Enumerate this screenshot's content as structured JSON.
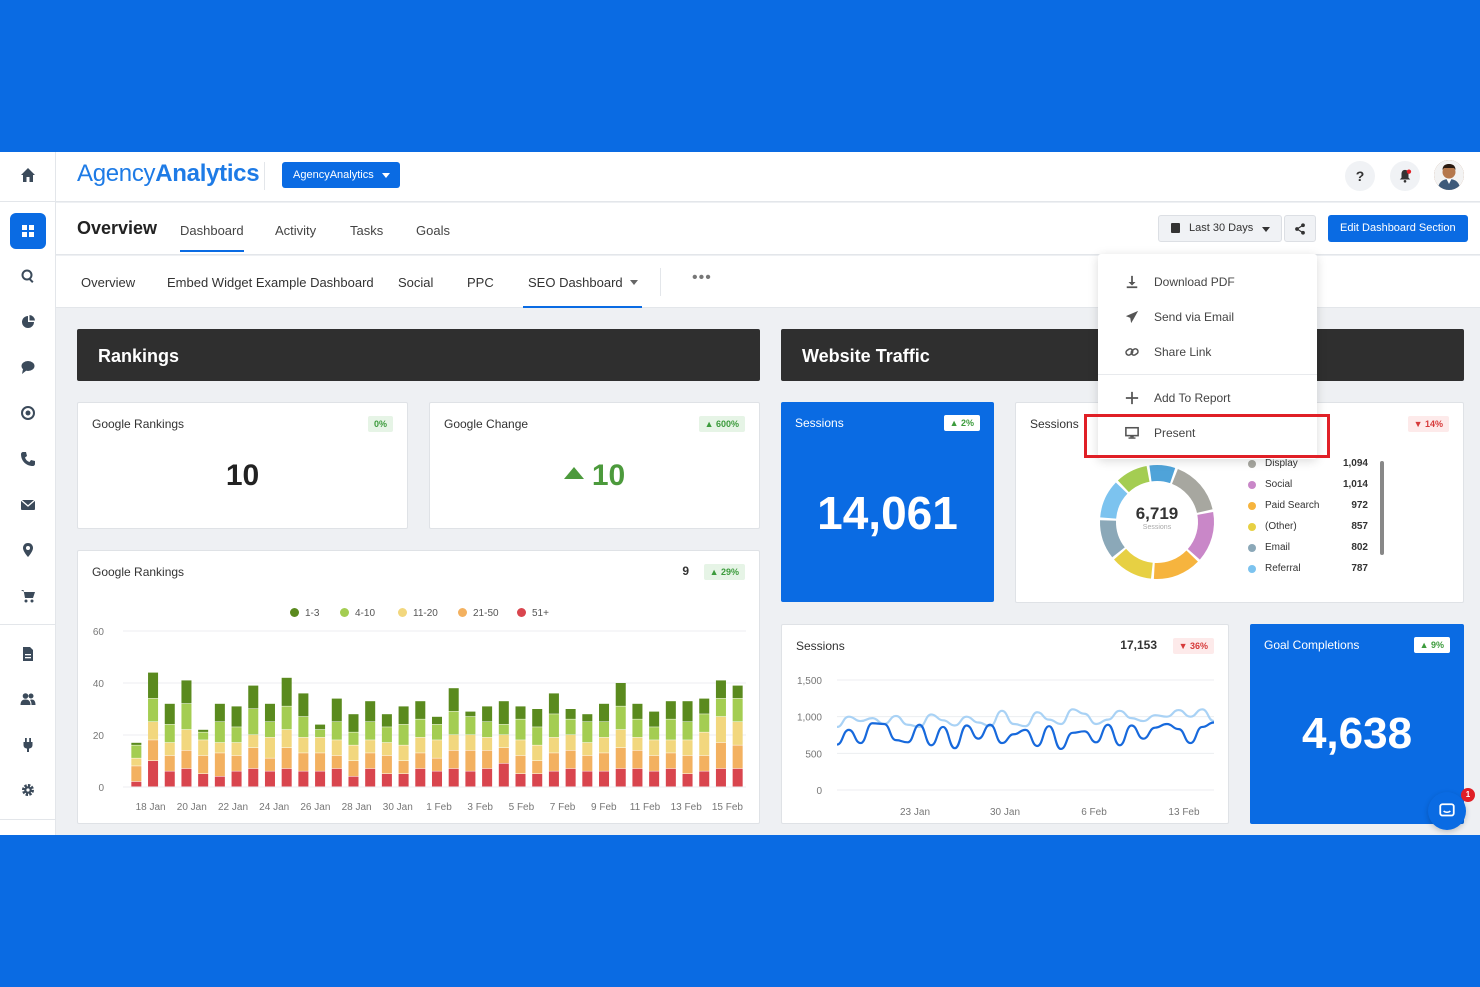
{
  "brand": {
    "logo_light": "Agency",
    "logo_bold": "Analytics",
    "account_button": "AgencyAnalytics"
  },
  "header": {
    "help": "?",
    "notification_count": ""
  },
  "nav": {
    "title": "Overview",
    "tabs": [
      "Dashboard",
      "Activity",
      "Tasks",
      "Goals"
    ],
    "date_range": "Last 30 Days",
    "edit_button": "Edit Dashboard Section"
  },
  "subtabs": [
    "Overview",
    "Embed Widget Example Dashboard",
    "Social",
    "PPC",
    "SEO Dashboard"
  ],
  "subtabs_more": "•••",
  "sections": {
    "rankings": "Rankings",
    "traffic": "Website Traffic"
  },
  "cards": {
    "google_rankings": {
      "title": "Google Rankings",
      "badge": "0%",
      "value": "10"
    },
    "google_change": {
      "title": "Google Change",
      "badge": "▲ 600%",
      "value": "10"
    },
    "rankings_chart": {
      "title": "Google Rankings",
      "value": "9",
      "badge": "▲ 29%"
    },
    "sessions": {
      "title": "Sessions",
      "badge": "▲ 2%",
      "value": "14,061"
    },
    "sessions_donut": {
      "title": "Sessions",
      "badge": "▼ 14%",
      "center_value": "6,719",
      "center_label": "Sessions"
    },
    "sessions_line": {
      "title": "Sessions",
      "value": "17,153",
      "badge": "▼ 36%"
    },
    "goal_completions": {
      "title": "Goal Completions",
      "badge": "▲ 9%",
      "value": "4,638"
    }
  },
  "traffic_sources": [
    {
      "name": "Display",
      "value": "1,094",
      "color": "#a7a7a0"
    },
    {
      "name": "Social",
      "value": "1,014",
      "color": "#c987c8"
    },
    {
      "name": "Paid Search",
      "value": "972",
      "color": "#f6b43e"
    },
    {
      "name": "(Other)",
      "value": "857",
      "color": "#e7d043"
    },
    {
      "name": "Email",
      "value": "802",
      "color": "#8ba8b8"
    },
    {
      "name": "Referral",
      "value": "787",
      "color": "#7cc3ef"
    }
  ],
  "dropdown": {
    "items": [
      "Download PDF",
      "Send via Email",
      "Share Link",
      "Add To Report",
      "Present"
    ]
  },
  "chat_badge": "1",
  "chart_data": [
    {
      "type": "bar",
      "stacked": true,
      "title": "Google Rankings",
      "x_labels": [
        "18 Jan",
        "20 Jan",
        "22 Jan",
        "24 Jan",
        "26 Jan",
        "28 Jan",
        "30 Jan",
        "1 Feb",
        "3 Feb",
        "5 Feb",
        "7 Feb",
        "9 Feb",
        "11 Feb",
        "13 Feb",
        "15 Feb"
      ],
      "y_ticks": [
        0,
        20,
        40,
        60
      ],
      "ylim": [
        0,
        60
      ],
      "legend": [
        {
          "name": "1-3",
          "color": "#5a8a1e"
        },
        {
          "name": "4-10",
          "color": "#a4cd52"
        },
        {
          "name": "11-20",
          "color": "#f2d77e"
        },
        {
          "name": "21-50",
          "color": "#f3b160"
        },
        {
          "name": "51+",
          "color": "#d9454e"
        }
      ],
      "stacks": [
        [
          1,
          5,
          3,
          6,
          2
        ],
        [
          10,
          9,
          7,
          8,
          10
        ],
        [
          8,
          7,
          5,
          6,
          6
        ],
        [
          9,
          10,
          8,
          7,
          7
        ],
        [
          1,
          3,
          6,
          7,
          5
        ],
        [
          7,
          8,
          4,
          9,
          4
        ],
        [
          8,
          6,
          5,
          6,
          6
        ],
        [
          9,
          10,
          5,
          8,
          7
        ],
        [
          7,
          6,
          8,
          5,
          6
        ],
        [
          11,
          9,
          7,
          8,
          7
        ],
        [
          9,
          8,
          6,
          7,
          6
        ],
        [
          2,
          3,
          6,
          7,
          6
        ],
        [
          9,
          7,
          6,
          5,
          7
        ],
        [
          7,
          5,
          6,
          6,
          4
        ],
        [
          8,
          7,
          5,
          6,
          7
        ],
        [
          5,
          6,
          5,
          7,
          5
        ],
        [
          7,
          8,
          6,
          5,
          5
        ],
        [
          7,
          7,
          6,
          6,
          7
        ],
        [
          3,
          6,
          7,
          5,
          6
        ],
        [
          9,
          9,
          6,
          7,
          7
        ],
        [
          2,
          7,
          6,
          8,
          6
        ],
        [
          6,
          6,
          5,
          7,
          7
        ],
        [
          9,
          4,
          5,
          6,
          9
        ],
        [
          5,
          8,
          6,
          7,
          5
        ],
        [
          7,
          7,
          6,
          5,
          5
        ],
        [
          8,
          9,
          6,
          7,
          6
        ],
        [
          4,
          6,
          6,
          7,
          7
        ],
        [
          3,
          8,
          5,
          6,
          6
        ],
        [
          7,
          6,
          6,
          7,
          6
        ],
        [
          9,
          9,
          7,
          8,
          7
        ],
        [
          6,
          7,
          5,
          7,
          7
        ],
        [
          6,
          5,
          6,
          6,
          6
        ],
        [
          7,
          8,
          5,
          6,
          7
        ],
        [
          8,
          7,
          6,
          7,
          5
        ],
        [
          6,
          7,
          9,
          6,
          6
        ],
        [
          7,
          7,
          10,
          10,
          7
        ],
        [
          5,
          9,
          9,
          9,
          7
        ]
      ]
    },
    {
      "type": "pie",
      "donut": true,
      "title": "Sessions",
      "labels": [
        "Display",
        "Social",
        "Paid Search",
        "(Other)",
        "Email",
        "Referral"
      ],
      "values": [
        1094,
        1014,
        972,
        857,
        802,
        787
      ]
    },
    {
      "type": "line",
      "title": "Sessions",
      "x_labels": [
        "23 Jan",
        "30 Jan",
        "6 Feb",
        "13 Feb"
      ],
      "y_ticks": [
        "0",
        "500",
        "1,000",
        "1,500"
      ],
      "ylim": [
        0,
        1500
      ],
      "series": [
        {
          "values": [
            620,
            820,
            640,
            910,
            900,
            680,
            650,
            890,
            610,
            860,
            570,
            880,
            700,
            890,
            640,
            760,
            820,
            600,
            870,
            560,
            780,
            800,
            650,
            890,
            610,
            880,
            700,
            850,
            900,
            830,
            640,
            860,
            920
          ],
          "color": "#1769dc"
        },
        {
          "values": [
            860,
            1000,
            940,
            980,
            900,
            1010,
            890,
            860,
            1030,
            950,
            880,
            1000,
            920,
            870,
            1080,
            900,
            870,
            1060,
            960,
            900,
            1100,
            1040,
            900,
            960,
            1080,
            980,
            940,
            1020,
            1000,
            1090,
            1000,
            1100,
            940
          ],
          "color": "#a9d2f5"
        }
      ]
    }
  ]
}
